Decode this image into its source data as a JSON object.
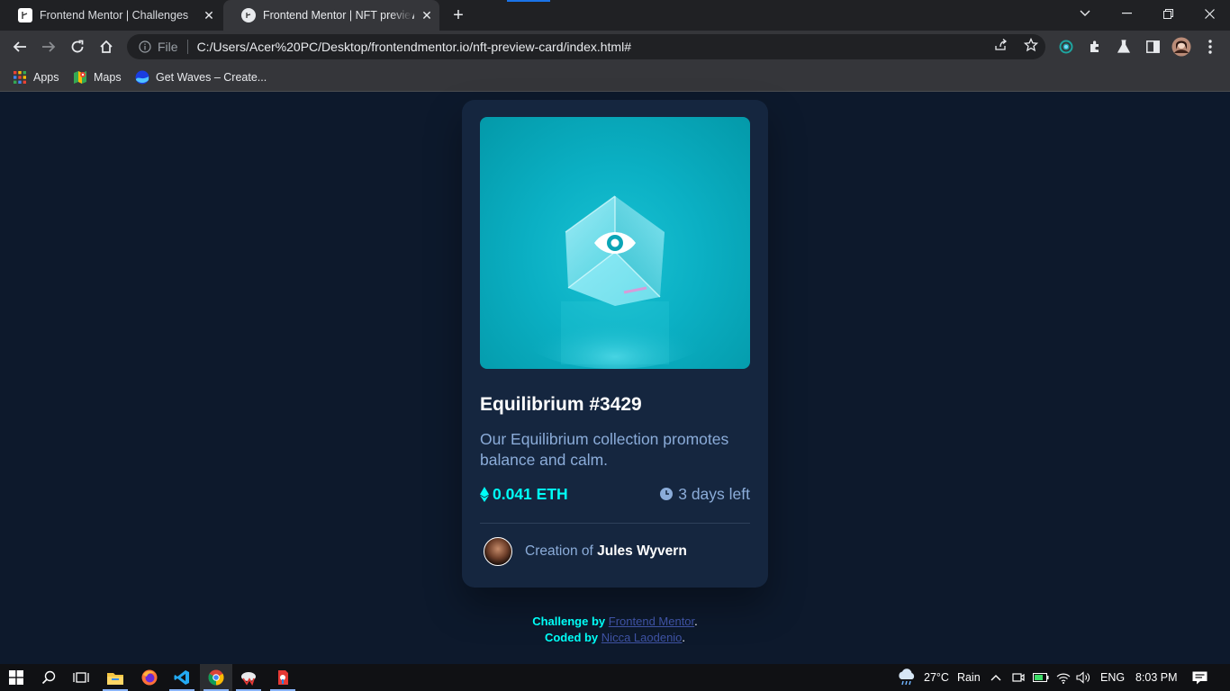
{
  "browser": {
    "tabs": [
      {
        "title": "Frontend Mentor | Challenges",
        "active": false
      },
      {
        "title": "Frontend Mentor | NFT preview card",
        "active": true
      }
    ],
    "address": {
      "scheme_label": "File",
      "url": "C:/Users/Acer%20PC/Desktop/frontendmentor.io/nft-preview-card/index.html#"
    },
    "bookmarks": [
      {
        "label": "Apps",
        "icon": "apps-grid-icon"
      },
      {
        "label": "Maps",
        "icon": "maps-icon"
      },
      {
        "label": "Get Waves – Create...",
        "icon": "waves-icon"
      }
    ],
    "accent_color": "#1a73e8"
  },
  "card": {
    "title": "Equilibrium #3429",
    "description": "Our Equilibrium collection promotes balance and calm.",
    "price": "0.041 ETH",
    "time_left": "3 days left",
    "creator_prefix": "Creation of",
    "creator_name": "Jules Wyvern",
    "colors": {
      "card_bg": "#15263f",
      "page_bg": "#0d192c",
      "cyan": "#00fff7",
      "soft_blue": "#8bacd9"
    }
  },
  "attribution": {
    "line1_prefix": "Challenge by",
    "line1_link": "Frontend Mentor",
    "line2_prefix": "Coded by",
    "line2_link": "Nicca Laodenio",
    "period": "."
  },
  "taskbar": {
    "weather": "27°C",
    "weather_desc": "Rain",
    "language": "ENG",
    "clock": "8:03 PM"
  }
}
